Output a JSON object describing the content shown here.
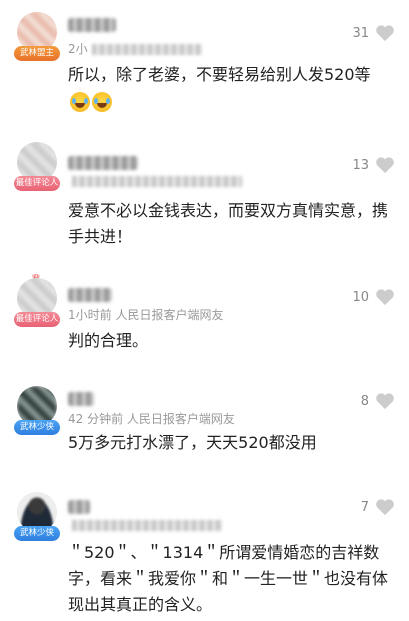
{
  "comments": [
    {
      "badge": "武林盟主",
      "meta": "2小",
      "text": "所以，除了老婆，不要轻易给别人发520等",
      "likes": "31",
      "emoji_count": 2
    },
    {
      "badge": "最佳评论人",
      "meta": "",
      "text": "爱意不必以金钱表达，而要双方真情实意，携手共进！",
      "likes": "13"
    },
    {
      "badge": "最佳评论人",
      "meta": "1小时前  人民日报客户端网友",
      "text": "判的合理。",
      "likes": "10"
    },
    {
      "badge": "武林少侠",
      "meta": "42 分钟前  人民日报客户端网友",
      "text": "5万多元打水漂了，天天520都没用",
      "likes": "8"
    },
    {
      "badge": "武林少侠",
      "meta": "",
      "text": "＂520＂、＂1314＂所谓爱情婚恋的吉祥数字，看来＂我爱你＂和＂一生一世＂也没有体现出其真正的含义。",
      "likes": "7"
    }
  ],
  "icons": {
    "heart": "heart-icon",
    "crown": "crown-icon",
    "emoji": "laughing-tears-emoji"
  },
  "colors": {
    "badge_orange": "#e8712a",
    "badge_pink": "#e86274",
    "badge_blue": "#2d7fe0",
    "heart_gray": "#cccccc"
  }
}
